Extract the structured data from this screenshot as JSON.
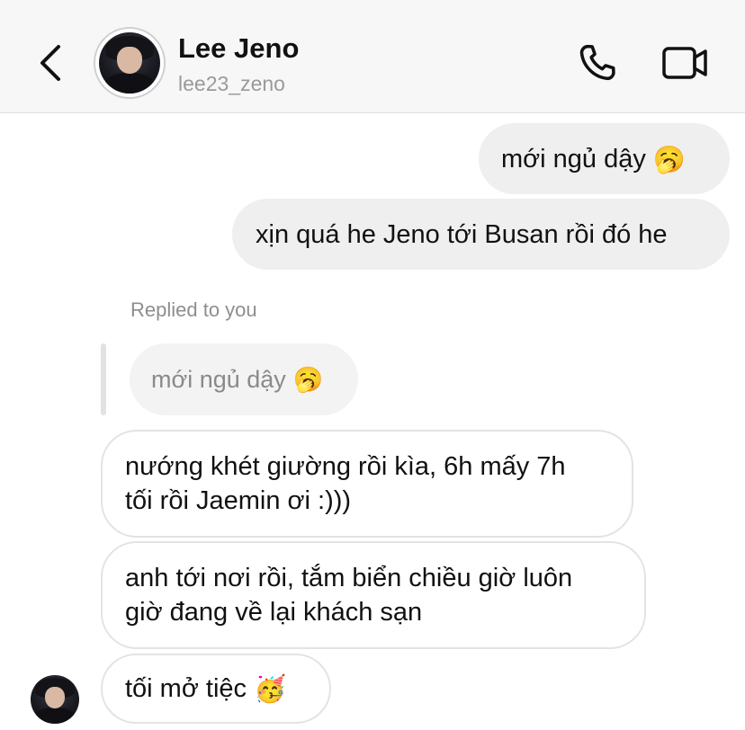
{
  "header": {
    "name": "Lee Jeno",
    "username": "lee23_zeno",
    "back_icon": "chevron-left-icon",
    "call_icon": "phone-icon",
    "video_icon": "video-camera-icon"
  },
  "messages": {
    "sent_1": {
      "text": "mới ngủ dậy",
      "emoji": "🥱"
    },
    "sent_2": {
      "text": "xịn quá he Jeno tới Busan rồi đó he"
    },
    "reply_label": "Replied to you",
    "replied": {
      "text": "mới ngủ dậy",
      "emoji": "🥱"
    },
    "recv_1": {
      "line1": "nướng khét giường rồi kìa, 6h mấy 7h",
      "line2": "tối rồi Jaemin ơi :)))"
    },
    "recv_2": {
      "line1": "anh tới nơi rồi, tắm biển chiều giờ luôn",
      "line2": "giờ đang về lại khách sạn"
    },
    "recv_3": {
      "text": "tối mở tiệc",
      "emoji": "🥳"
    }
  },
  "colors": {
    "header_bg": "#f7f7f7",
    "sent_bubble": "#efefef",
    "received_bubble_border": "#e3e3e3",
    "secondary_text": "#8e8e8e"
  }
}
